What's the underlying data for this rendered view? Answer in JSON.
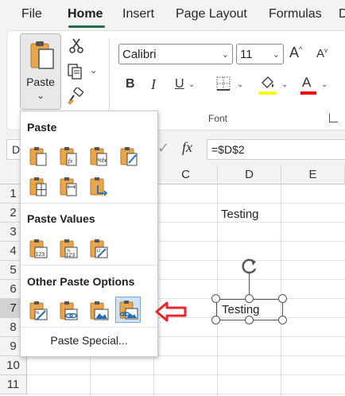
{
  "menu": {
    "tabs": [
      "File",
      "Home",
      "Insert",
      "Page Layout",
      "Formulas",
      "D"
    ],
    "active": "Home"
  },
  "ribbon": {
    "paste_label": "Paste",
    "font_name": "Calibri",
    "font_size": "11",
    "grow_font": "A",
    "shrink_font": "A",
    "bold": "B",
    "italic": "I",
    "underline": "U",
    "font_color_letter": "A",
    "group_label": "Font",
    "fill_color": "#ffff00",
    "font_color": "#ff0000"
  },
  "formula_bar": {
    "name_box": "D",
    "fx": "fx",
    "formula": "=$D$2"
  },
  "grid": {
    "columns": [
      "C",
      "D",
      "E"
    ],
    "rows": [
      "1",
      "2",
      "3",
      "4",
      "5",
      "6",
      "7",
      "8",
      "9",
      "10",
      "11"
    ],
    "selected_row": "7",
    "cells": [
      {
        "ref": "D2",
        "text": "Testing"
      },
      {
        "ref": "D7",
        "text": "Testing"
      }
    ]
  },
  "paste_menu": {
    "sections": [
      {
        "title": "Paste",
        "icons": [
          "paste-icon",
          "paste-formulas-icon",
          "paste-formulas-number-format-icon",
          "keep-source-formatting-icon",
          "no-borders-icon",
          "keep-column-widths-icon",
          "transpose-icon"
        ]
      },
      {
        "title": "Paste Values",
        "icons": [
          "values-icon",
          "values-number-format-icon",
          "values-source-formatting-icon"
        ]
      },
      {
        "title": "Other Paste Options",
        "icons": [
          "formatting-icon",
          "paste-link-icon",
          "picture-icon",
          "linked-picture-icon"
        ]
      }
    ],
    "selected_option": "linked-picture-icon",
    "special_label": "Paste Special..."
  },
  "colors": {
    "accent": "#1e7145",
    "arrow": "#e8262b",
    "selected_option_bg": "#cde3f7"
  }
}
